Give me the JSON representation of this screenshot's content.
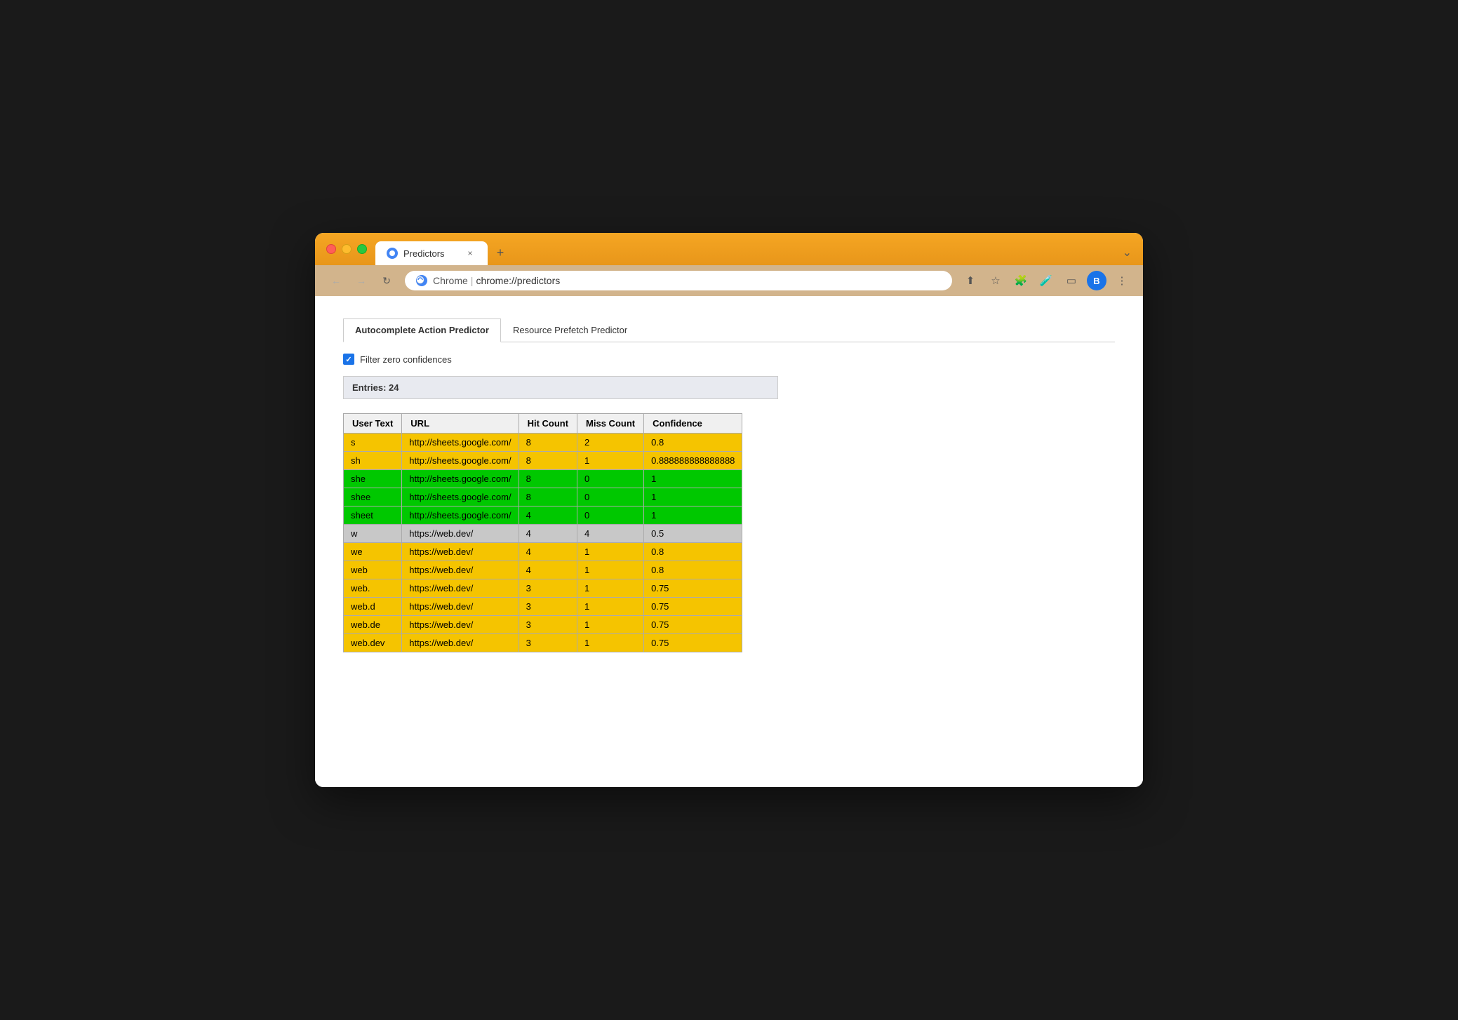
{
  "browser": {
    "title_bar_tab": "Predictors",
    "tab_close": "×",
    "tab_new": "+",
    "tab_extra": "⌄",
    "nav_back": "←",
    "nav_forward": "→",
    "nav_refresh": "↻",
    "omnibox_site": "Chrome",
    "omnibox_sep": "|",
    "omnibox_url": "chrome://predictors",
    "toolbar_share": "⬆",
    "toolbar_star": "☆",
    "toolbar_ext": "🧩",
    "toolbar_dropper": "🧪",
    "toolbar_sidebar": "▭",
    "toolbar_avatar": "B",
    "toolbar_menu": "⋮"
  },
  "page": {
    "tab_active": "Autocomplete Action Predictor",
    "tab_inactive": "Resource Prefetch Predictor",
    "filter_label": "Filter zero confidences",
    "entries_label": "Entries: 24",
    "table": {
      "headers": [
        "User Text",
        "URL",
        "Hit Count",
        "Miss Count",
        "Confidence"
      ],
      "rows": [
        {
          "user_text": "s",
          "url": "http://sheets.google.com/",
          "hit_count": "8",
          "miss_count": "2",
          "confidence": "0.8",
          "color": "yellow"
        },
        {
          "user_text": "sh",
          "url": "http://sheets.google.com/",
          "hit_count": "8",
          "miss_count": "1",
          "confidence": "0.888888888888888",
          "color": "yellow"
        },
        {
          "user_text": "she",
          "url": "http://sheets.google.com/",
          "hit_count": "8",
          "miss_count": "0",
          "confidence": "1",
          "color": "green"
        },
        {
          "user_text": "shee",
          "url": "http://sheets.google.com/",
          "hit_count": "8",
          "miss_count": "0",
          "confidence": "1",
          "color": "green"
        },
        {
          "user_text": "sheet",
          "url": "http://sheets.google.com/",
          "hit_count": "4",
          "miss_count": "0",
          "confidence": "1",
          "color": "green"
        },
        {
          "user_text": "w",
          "url": "https://web.dev/",
          "hit_count": "4",
          "miss_count": "4",
          "confidence": "0.5",
          "color": "gray"
        },
        {
          "user_text": "we",
          "url": "https://web.dev/",
          "hit_count": "4",
          "miss_count": "1",
          "confidence": "0.8",
          "color": "yellow"
        },
        {
          "user_text": "web",
          "url": "https://web.dev/",
          "hit_count": "4",
          "miss_count": "1",
          "confidence": "0.8",
          "color": "yellow"
        },
        {
          "user_text": "web.",
          "url": "https://web.dev/",
          "hit_count": "3",
          "miss_count": "1",
          "confidence": "0.75",
          "color": "yellow"
        },
        {
          "user_text": "web.d",
          "url": "https://web.dev/",
          "hit_count": "3",
          "miss_count": "1",
          "confidence": "0.75",
          "color": "yellow"
        },
        {
          "user_text": "web.de",
          "url": "https://web.dev/",
          "hit_count": "3",
          "miss_count": "1",
          "confidence": "0.75",
          "color": "yellow"
        },
        {
          "user_text": "web.dev",
          "url": "https://web.dev/",
          "hit_count": "3",
          "miss_count": "1",
          "confidence": "0.75",
          "color": "yellow"
        }
      ]
    }
  }
}
